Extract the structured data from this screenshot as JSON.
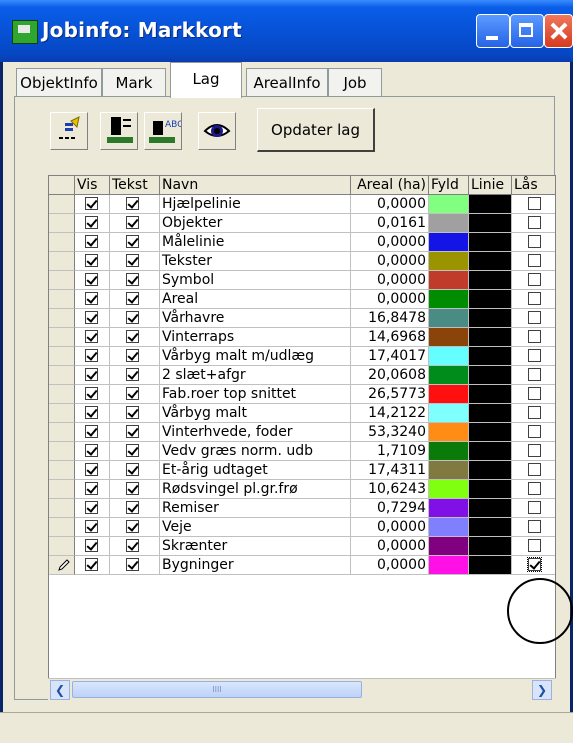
{
  "window": {
    "title": "Jobinfo: Markkort"
  },
  "tabs": [
    {
      "label": "ObjektInfo"
    },
    {
      "label": "Mark"
    },
    {
      "label": "Lag"
    },
    {
      "label": "ArealInfo"
    },
    {
      "label": "Job"
    }
  ],
  "active_tab": "Lag",
  "toolbar": {
    "update_label": "Opdater lag",
    "icons": [
      "layer-properties-icon",
      "layer-line-icon",
      "layer-label-icon",
      "visibility-eye-icon"
    ]
  },
  "grid": {
    "columns": [
      "Vis",
      "Tekst",
      "Navn",
      "Areal (ha)",
      "Fyld",
      "Linie",
      "Lås"
    ],
    "rows": [
      {
        "vis": true,
        "tekst": true,
        "name": "Hjælpelinie",
        "area": "0,0000",
        "fill": "#80ff80",
        "line": "#000000",
        "locked": false
      },
      {
        "vis": true,
        "tekst": true,
        "name": "Objekter",
        "area": "0,0161",
        "fill": "#a0a0a0",
        "line": "#000000",
        "locked": false
      },
      {
        "vis": true,
        "tekst": true,
        "name": "Målelinie",
        "area": "0,0000",
        "fill": "#1414e6",
        "line": "#000000",
        "locked": false
      },
      {
        "vis": true,
        "tekst": true,
        "name": "Tekster",
        "area": "0,0000",
        "fill": "#999400",
        "line": "#000000",
        "locked": false
      },
      {
        "vis": true,
        "tekst": true,
        "name": "Symbol",
        "area": "0,0000",
        "fill": "#c03b2a",
        "line": "#000000",
        "locked": false
      },
      {
        "vis": true,
        "tekst": true,
        "name": "Areal",
        "area": "0,0000",
        "fill": "#008c00",
        "line": "#000000",
        "locked": false
      },
      {
        "vis": true,
        "tekst": true,
        "name": "Vårhavre",
        "area": "16,8478",
        "fill": "#4a8c84",
        "line": "#000000",
        "locked": false
      },
      {
        "vis": true,
        "tekst": true,
        "name": "Vinterraps",
        "area": "14,6968",
        "fill": "#8a4308",
        "line": "#000000",
        "locked": false
      },
      {
        "vis": true,
        "tekst": true,
        "name": "Vårbyg malt m/udlæg",
        "area": "17,4017",
        "fill": "#66ffff",
        "line": "#000000",
        "locked": false
      },
      {
        "vis": true,
        "tekst": true,
        "name": "2 slæt+afgr",
        "area": "20,0608",
        "fill": "#008c1a",
        "line": "#000000",
        "locked": false
      },
      {
        "vis": true,
        "tekst": true,
        "name": "Fab.roer top snittet",
        "area": "26,5773",
        "fill": "#ff1010",
        "line": "#000000",
        "locked": false
      },
      {
        "vis": true,
        "tekst": true,
        "name": "Vårbyg malt",
        "area": "14,2122",
        "fill": "#80ffff",
        "line": "#000000",
        "locked": false
      },
      {
        "vis": true,
        "tekst": true,
        "name": "Vinterhvede, foder",
        "area": "53,3240",
        "fill": "#ff8c14",
        "line": "#000000",
        "locked": false
      },
      {
        "vis": true,
        "tekst": true,
        "name": "Vedv græs norm. udb",
        "area": "1,7109",
        "fill": "#0a7a0a",
        "line": "#000000",
        "locked": false
      },
      {
        "vis": true,
        "tekst": true,
        "name": "Et-årig udtaget",
        "area": "17,4311",
        "fill": "#807a40",
        "line": "#000000",
        "locked": false
      },
      {
        "vis": true,
        "tekst": true,
        "name": "Rødsvingel pl.gr.frø",
        "area": "10,6243",
        "fill": "#80ff10",
        "line": "#000000",
        "locked": false
      },
      {
        "vis": true,
        "tekst": true,
        "name": "Remiser",
        "area": "0,7294",
        "fill": "#8010e6",
        "line": "#000000",
        "locked": false
      },
      {
        "vis": true,
        "tekst": true,
        "name": "Veje",
        "area": "0,0000",
        "fill": "#8080ff",
        "line": "#000000",
        "locked": false
      },
      {
        "vis": true,
        "tekst": true,
        "name": "Skrænter",
        "area": "0,0000",
        "fill": "#800080",
        "line": "#000000",
        "locked": false
      },
      {
        "vis": true,
        "tekst": true,
        "name": "Bygninger",
        "area": "0,0000",
        "fill": "#ff10e6",
        "line": "#000000",
        "locked": true,
        "editing": true
      }
    ]
  },
  "scrollbar": {
    "thumb_grip": "IIII"
  }
}
